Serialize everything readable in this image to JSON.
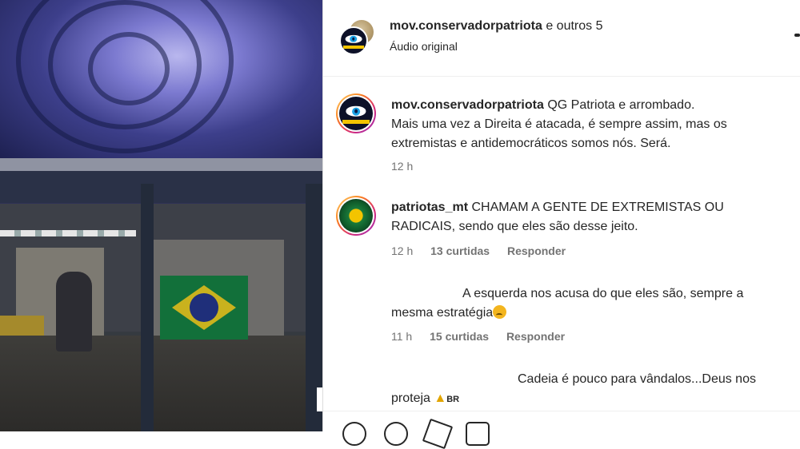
{
  "header": {
    "username": "mov.conservadorpatriota",
    "others": "e outros 5",
    "audio": "Áudio original"
  },
  "comments": [
    {
      "username": "mov.conservadorpatriota",
      "line1": "QG Patriota e arrombado.",
      "line2": "Mais uma vez a Direita é atacada, é sempre assim, mas os",
      "line3": "extremistas e antidemocráticos somos nós. Será.",
      "time": "12 h"
    },
    {
      "username": "patriotas_mt",
      "line1": "CHAMAM A GENTE DE EXTREMISTAS OU",
      "line2": "RADICAIS, sendo que eles são desse jeito.",
      "time": "12 h",
      "likes": "13 curtidas",
      "reply": "Responder"
    },
    {
      "line1": "A esquerda nos acusa do que eles são, sempre a",
      "line2": "mesma estratégia",
      "time": "11 h",
      "likes": "15 curtidas",
      "reply": "Responder"
    },
    {
      "line1": "Cadeia é pouco para vândalos...Deus nos",
      "line2": "proteja",
      "flag_text": "BR"
    }
  ],
  "icons": [
    "heart-icon",
    "comment-icon",
    "share-icon",
    "save-icon",
    "more-options-icon",
    "sad-emoji-icon",
    "praying-hands-icon"
  ],
  "colors": {
    "text": "#262626",
    "secondary": "#737373",
    "divider": "#dbdbdb"
  }
}
